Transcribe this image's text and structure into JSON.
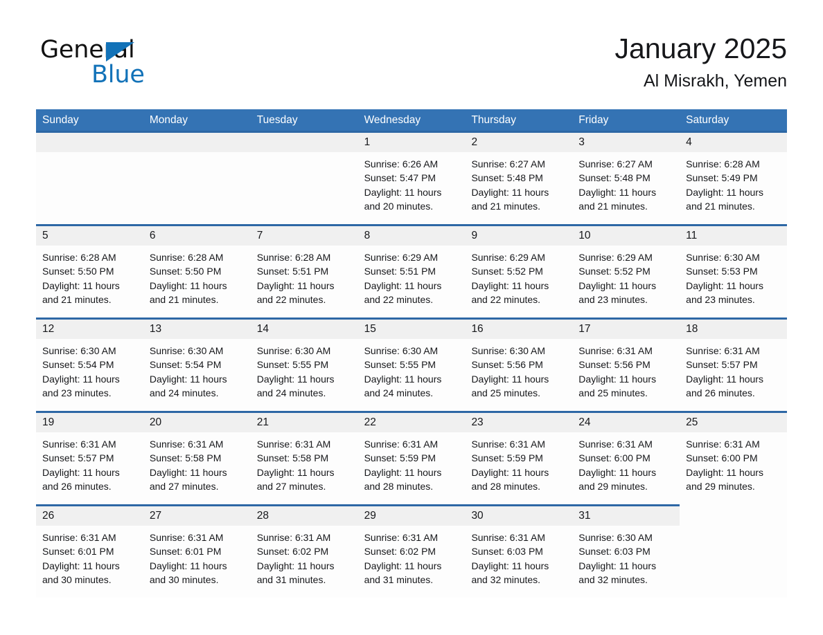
{
  "brand": {
    "word_one": "General",
    "word_two": "Blue",
    "accent_color": "#1272b8",
    "triangle_icon": "triangle-icon"
  },
  "header": {
    "title": "January 2025",
    "subtitle": "Al Misrakh, Yemen",
    "header_bg": "#3473b4",
    "row_rule_color": "#2d67a5",
    "daynum_band_color": "#f0f0f0"
  },
  "weekdays": [
    "Sunday",
    "Monday",
    "Tuesday",
    "Wednesday",
    "Thursday",
    "Friday",
    "Saturday"
  ],
  "weeks": [
    [
      {
        "blank": true
      },
      {
        "blank": true
      },
      {
        "blank": true
      },
      {
        "day": "1",
        "sunrise": "Sunrise: 6:26 AM",
        "sunset": "Sunset: 5:47 PM",
        "daylight": "Daylight: 11 hours and 20 minutes."
      },
      {
        "day": "2",
        "sunrise": "Sunrise: 6:27 AM",
        "sunset": "Sunset: 5:48 PM",
        "daylight": "Daylight: 11 hours and 21 minutes."
      },
      {
        "day": "3",
        "sunrise": "Sunrise: 6:27 AM",
        "sunset": "Sunset: 5:48 PM",
        "daylight": "Daylight: 11 hours and 21 minutes."
      },
      {
        "day": "4",
        "sunrise": "Sunrise: 6:28 AM",
        "sunset": "Sunset: 5:49 PM",
        "daylight": "Daylight: 11 hours and 21 minutes."
      }
    ],
    [
      {
        "day": "5",
        "sunrise": "Sunrise: 6:28 AM",
        "sunset": "Sunset: 5:50 PM",
        "daylight": "Daylight: 11 hours and 21 minutes."
      },
      {
        "day": "6",
        "sunrise": "Sunrise: 6:28 AM",
        "sunset": "Sunset: 5:50 PM",
        "daylight": "Daylight: 11 hours and 21 minutes."
      },
      {
        "day": "7",
        "sunrise": "Sunrise: 6:28 AM",
        "sunset": "Sunset: 5:51 PM",
        "daylight": "Daylight: 11 hours and 22 minutes."
      },
      {
        "day": "8",
        "sunrise": "Sunrise: 6:29 AM",
        "sunset": "Sunset: 5:51 PM",
        "daylight": "Daylight: 11 hours and 22 minutes."
      },
      {
        "day": "9",
        "sunrise": "Sunrise: 6:29 AM",
        "sunset": "Sunset: 5:52 PM",
        "daylight": "Daylight: 11 hours and 22 minutes."
      },
      {
        "day": "10",
        "sunrise": "Sunrise: 6:29 AM",
        "sunset": "Sunset: 5:52 PM",
        "daylight": "Daylight: 11 hours and 23 minutes."
      },
      {
        "day": "11",
        "sunrise": "Sunrise: 6:30 AM",
        "sunset": "Sunset: 5:53 PM",
        "daylight": "Daylight: 11 hours and 23 minutes."
      }
    ],
    [
      {
        "day": "12",
        "sunrise": "Sunrise: 6:30 AM",
        "sunset": "Sunset: 5:54 PM",
        "daylight": "Daylight: 11 hours and 23 minutes."
      },
      {
        "day": "13",
        "sunrise": "Sunrise: 6:30 AM",
        "sunset": "Sunset: 5:54 PM",
        "daylight": "Daylight: 11 hours and 24 minutes."
      },
      {
        "day": "14",
        "sunrise": "Sunrise: 6:30 AM",
        "sunset": "Sunset: 5:55 PM",
        "daylight": "Daylight: 11 hours and 24 minutes."
      },
      {
        "day": "15",
        "sunrise": "Sunrise: 6:30 AM",
        "sunset": "Sunset: 5:55 PM",
        "daylight": "Daylight: 11 hours and 24 minutes."
      },
      {
        "day": "16",
        "sunrise": "Sunrise: 6:30 AM",
        "sunset": "Sunset: 5:56 PM",
        "daylight": "Daylight: 11 hours and 25 minutes."
      },
      {
        "day": "17",
        "sunrise": "Sunrise: 6:31 AM",
        "sunset": "Sunset: 5:56 PM",
        "daylight": "Daylight: 11 hours and 25 minutes."
      },
      {
        "day": "18",
        "sunrise": "Sunrise: 6:31 AM",
        "sunset": "Sunset: 5:57 PM",
        "daylight": "Daylight: 11 hours and 26 minutes."
      }
    ],
    [
      {
        "day": "19",
        "sunrise": "Sunrise: 6:31 AM",
        "sunset": "Sunset: 5:57 PM",
        "daylight": "Daylight: 11 hours and 26 minutes."
      },
      {
        "day": "20",
        "sunrise": "Sunrise: 6:31 AM",
        "sunset": "Sunset: 5:58 PM",
        "daylight": "Daylight: 11 hours and 27 minutes."
      },
      {
        "day": "21",
        "sunrise": "Sunrise: 6:31 AM",
        "sunset": "Sunset: 5:58 PM",
        "daylight": "Daylight: 11 hours and 27 minutes."
      },
      {
        "day": "22",
        "sunrise": "Sunrise: 6:31 AM",
        "sunset": "Sunset: 5:59 PM",
        "daylight": "Daylight: 11 hours and 28 minutes."
      },
      {
        "day": "23",
        "sunrise": "Sunrise: 6:31 AM",
        "sunset": "Sunset: 5:59 PM",
        "daylight": "Daylight: 11 hours and 28 minutes."
      },
      {
        "day": "24",
        "sunrise": "Sunrise: 6:31 AM",
        "sunset": "Sunset: 6:00 PM",
        "daylight": "Daylight: 11 hours and 29 minutes."
      },
      {
        "day": "25",
        "sunrise": "Sunrise: 6:31 AM",
        "sunset": "Sunset: 6:00 PM",
        "daylight": "Daylight: 11 hours and 29 minutes."
      }
    ],
    [
      {
        "day": "26",
        "sunrise": "Sunrise: 6:31 AM",
        "sunset": "Sunset: 6:01 PM",
        "daylight": "Daylight: 11 hours and 30 minutes."
      },
      {
        "day": "27",
        "sunrise": "Sunrise: 6:31 AM",
        "sunset": "Sunset: 6:01 PM",
        "daylight": "Daylight: 11 hours and 30 minutes."
      },
      {
        "day": "28",
        "sunrise": "Sunrise: 6:31 AM",
        "sunset": "Sunset: 6:02 PM",
        "daylight": "Daylight: 11 hours and 31 minutes."
      },
      {
        "day": "29",
        "sunrise": "Sunrise: 6:31 AM",
        "sunset": "Sunset: 6:02 PM",
        "daylight": "Daylight: 11 hours and 31 minutes."
      },
      {
        "day": "30",
        "sunrise": "Sunrise: 6:31 AM",
        "sunset": "Sunset: 6:03 PM",
        "daylight": "Daylight: 11 hours and 32 minutes."
      },
      {
        "day": "31",
        "sunrise": "Sunrise: 6:30 AM",
        "sunset": "Sunset: 6:03 PM",
        "daylight": "Daylight: 11 hours and 32 minutes."
      },
      {
        "blank": true
      }
    ]
  ]
}
